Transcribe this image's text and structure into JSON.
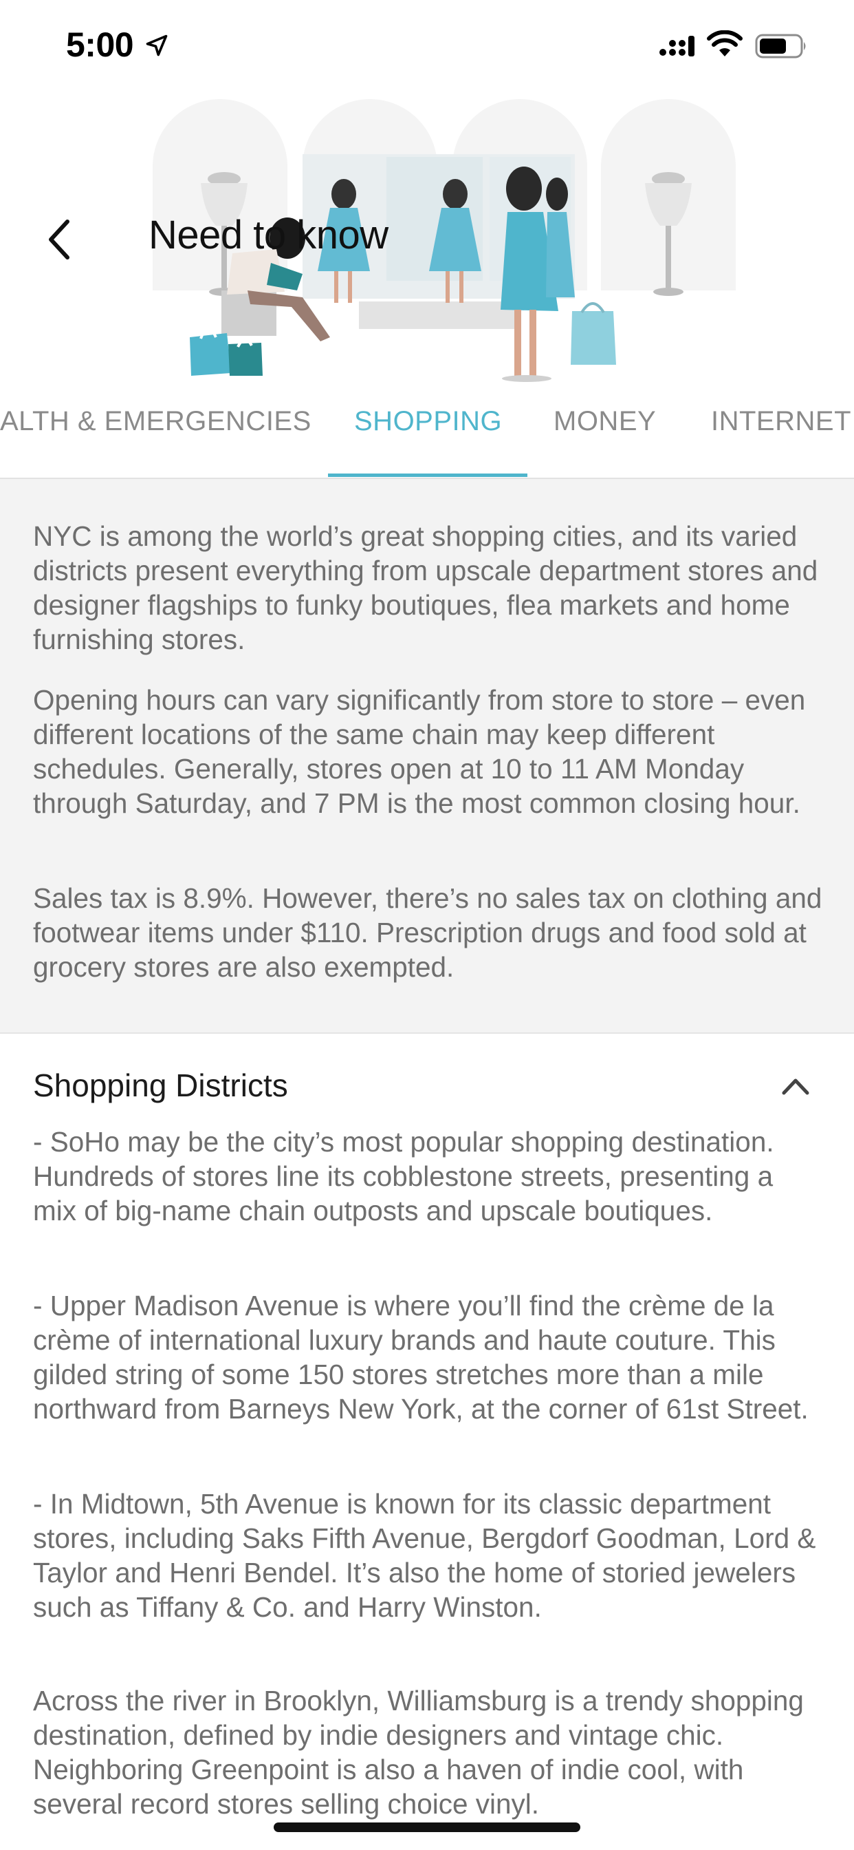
{
  "status_bar": {
    "time": "5:00",
    "icons": [
      "location-arrow-icon",
      "signal-icon",
      "wifi-icon",
      "battery-icon"
    ]
  },
  "header": {
    "title": "Need to know",
    "back_icon": "chevron-left-icon",
    "illustration": "shopping-boutique-illustration"
  },
  "tabs": {
    "items": [
      {
        "label": "HEALTH & EMERGENCIES",
        "visible_text": "ALTH & EMERGENCIES",
        "active": false
      },
      {
        "label": "SHOPPING",
        "active": true
      },
      {
        "label": "MONEY",
        "active": false
      },
      {
        "label": "INTERNET",
        "active": false
      }
    ]
  },
  "intro": {
    "paragraphs": [
      "NYC is among the world’s great shopping cities, and its varied districts present everything from upscale department stores and designer flagships to funky boutiques, flea markets and home furnishing stores.",
      "Opening hours can vary significantly from store to store – even different locations of the same chain may keep different schedules. Generally, stores open at 10 to 11 AM Monday through Saturday, and 7 PM is the most common closing hour.",
      "Sales tax is 8.9%. However, there’s no sales tax on clothing and footwear items under $110. Prescription drugs and food sold at grocery stores are also exempted."
    ]
  },
  "districts": {
    "title": "Shopping Districts",
    "expanded": true,
    "toggle_icon": "chevron-up-icon",
    "paragraphs": [
      "- SoHo may be the city’s most popular shopping destination. Hundreds of stores line its cobblestone streets, presenting a mix of big-name chain outposts and upscale boutiques.",
      "- Upper Madison Avenue is where you’ll find the crème de la crème of international luxury brands and haute couture. This gilded string of some 150 stores stretches more than a mile northward from Barneys New York, at the corner of 61st Street.",
      "- In Midtown, 5th Avenue is known for its classic department stores, including Saks Fifth Avenue, Bergdorf Goodman, Lord & Taylor and Henri Bendel. It’s also the home of storied jewelers such as Tiffany & Co. and Harry Winston.",
      "Across the river in Brooklyn, Williamsburg is a trendy shopping destination, defined by indie designers and vintage chic. Neighboring Greenpoint is also a haven of indie cool, with several record stores selling choice vinyl."
    ]
  },
  "colors": {
    "accent": "#4fb5cc",
    "body_text": "#6e6e6e",
    "intro_bg": "#f3f3f3"
  }
}
